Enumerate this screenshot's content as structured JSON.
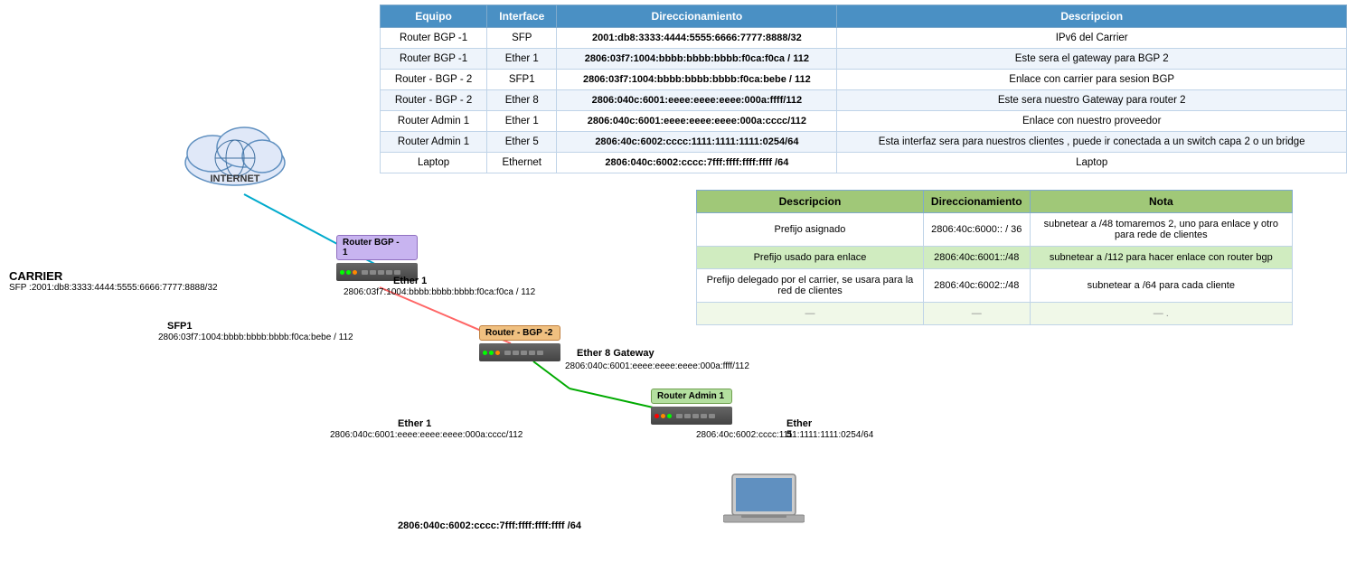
{
  "table": {
    "headers": [
      "Equipo",
      "Interface",
      "Direccionamiento",
      "Descripcion"
    ],
    "rows": [
      {
        "equipo": "Router BGP -1",
        "interface": "SFP",
        "direccionamiento": "2001:db8:3333:4444:5555:6666:7777:8888/32",
        "descripcion": "IPv6 del Carrier"
      },
      {
        "equipo": "Router BGP -1",
        "interface": "Ether 1",
        "direccionamiento": "2806:03f7:1004:bbbb:bbbb:bbbb:f0ca:f0ca / 112",
        "descripcion": "Este sera el gateway para BGP 2"
      },
      {
        "equipo": "Router - BGP - 2",
        "interface": "SFP1",
        "direccionamiento": "2806:03f7:1004:bbbb:bbbb:bbbb:f0ca:bebe / 112",
        "descripcion": "Enlace con carrier para sesion BGP"
      },
      {
        "equipo": "Router - BGP - 2",
        "interface": "Ether 8",
        "direccionamiento": "2806:040c:6001:eeee:eeee:eeee:000a:ffff/112",
        "descripcion": "Este sera nuestro Gateway para router 2"
      },
      {
        "equipo": "Router Admin 1",
        "interface": "Ether 1",
        "direccionamiento": "2806:040c:6001:eeee:eeee:eeee:000a:cccc/112",
        "descripcion": "Enlace con nuestro proveedor"
      },
      {
        "equipo": "Router Admin 1",
        "interface": "Ether 5",
        "direccionamiento": "2806:40c:6002:cccc:1111:1111:1111:0254/64",
        "descripcion": "Esta interfaz sera para nuestros clientes , puede ir conectada a un switch capa 2 o un bridge"
      },
      {
        "equipo": "Laptop",
        "interface": "Ethernet",
        "direccionamiento": "2806:040c:6002:cccc:7fff:ffff:ffff:ffff /64",
        "descripcion": "Laptop"
      }
    ]
  },
  "second_table": {
    "headers": [
      "Descripcion",
      "Direccionamiento",
      "Nota"
    ],
    "rows": [
      {
        "descripcion": "Prefijo asignado",
        "direccionamiento": "2806:40c:6000:: / 36",
        "nota": "subnetear a /48  tomaremos 2, uno para enlace y otro para rede de clientes"
      },
      {
        "descripcion": "Prefijo usado para enlace",
        "direccionamiento": "2806:40c:6001::/48",
        "nota": "subnetear a /112 para hacer enlace con router bgp"
      },
      {
        "descripcion": "Prefijo delegado por el carrier, se usara para la red de clientes",
        "direccionamiento": "2806:40c:6002::/48",
        "nota": "subnetear a /64 para cada cliente"
      },
      {
        "descripcion": "—",
        "direccionamiento": "—",
        "nota": "— ."
      }
    ]
  },
  "diagram": {
    "internet_label": "INTERNET",
    "carrier_label": "CARRIER",
    "carrier_ip": "SFP :2001:db8:3333:4444:5555:6666:7777:8888/32",
    "router_bgp1_label": "Router BGP -\n1",
    "router_bgp1_ether1": "Ether 1",
    "router_bgp1_ether1_ip": "2806:03f7:1004:bbbb:bbbb:bbbb:f0ca:f0ca / 112",
    "router_bgp2_label": "Router - BGP -2",
    "router_bgp2_sfp1": "SFP1",
    "router_bgp2_sfp1_ip": "2806:03f7:1004:bbbb:bbbb:bbbb:f0ca:bebe / 112",
    "router_bgp2_ether8": "Ether 8 Gateway",
    "router_bgp2_ether8_ip": "2806:040c:6001:eeee:eeee:eeee:000a:ffff/112",
    "router_admin1_label": "Router Admin 1",
    "router_admin1_ether1": "Ether 1",
    "router_admin1_ether1_ip": "2806:040c:6001:eeee:eeee:eeee:000a:cccc/112",
    "router_admin1_ether5": "Ether 5",
    "router_admin1_ether5_ip": "2806:40c:6002:cccc:1111:1111:1111:0254/64",
    "laptop_ip": "2806:040c:6002:cccc:7fff:ffff:ffff:ffff /64"
  }
}
